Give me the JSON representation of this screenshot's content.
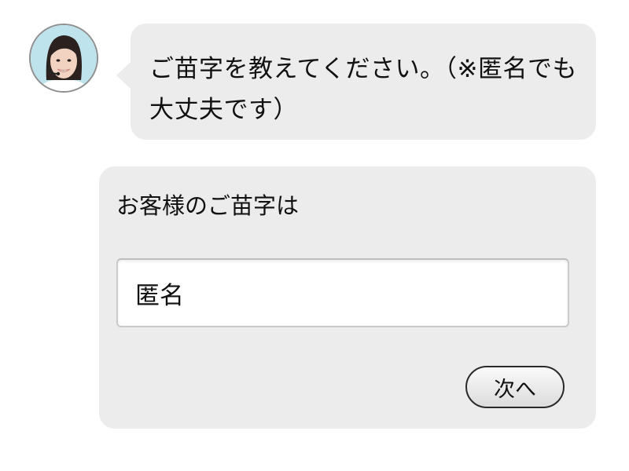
{
  "chat": {
    "operator_message": "ご苗字を教えてください。（※匿名でも大丈夫です）"
  },
  "form": {
    "label": "お客様のご苗字は",
    "surname_value": "匿名",
    "next_button_label": "次へ"
  },
  "icons": {
    "avatar": "operator-avatar-icon"
  },
  "colors": {
    "bubble_background": "#ececec",
    "text": "#111111",
    "input_border": "#c9c9c9",
    "button_border": "#2a2a2a"
  }
}
